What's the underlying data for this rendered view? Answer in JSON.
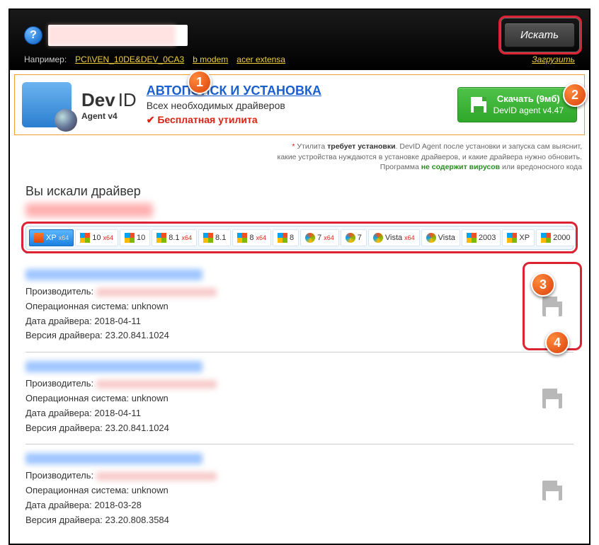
{
  "header": {
    "help_glyph": "?",
    "search_value": "",
    "search_button": "Искать",
    "example_label": "Например:",
    "example_links": [
      "PCI\\VEN_10DE&DEV_0CA3",
      "b modem",
      "acer extensa"
    ],
    "upload_link": "Загрузить"
  },
  "promo": {
    "brand_bold": "Dev",
    "brand_light": "ID",
    "agent_label": "Agent v4",
    "headline": "АВТОПОИСК И УСТАНОВКА",
    "subline": "Всех необходимых драйверов",
    "free_label": "Бесплатная утилита",
    "download_title": "Скачать (9мб)",
    "download_sub": "DevID agent v4.47"
  },
  "fineprint": {
    "star": "*",
    "line1_a": "Утилита ",
    "line1_b": "требует установки",
    "line1_c": ". DevID Agent после установки и запуска сам выяснит,",
    "line2": "какие устройства нуждаются в установке драйверов, и какие драйвера нужно обновить.",
    "line3_a": "Программа ",
    "line3_b": "не содержит вирусов",
    "line3_c": " или вредоносного кода"
  },
  "results": {
    "heading": "Вы искали драйвер",
    "os_tabs": [
      {
        "label": "XP",
        "sup": "x64",
        "active": true,
        "icon": "xp"
      },
      {
        "label": "10",
        "sup": "x64",
        "icon": "flag"
      },
      {
        "label": "10",
        "sup": "",
        "icon": "flag"
      },
      {
        "label": "8.1",
        "sup": "x64",
        "icon": "flag"
      },
      {
        "label": "8.1",
        "sup": "",
        "icon": "flag"
      },
      {
        "label": "8",
        "sup": "x64",
        "icon": "flag"
      },
      {
        "label": "8",
        "sup": "",
        "icon": "flag"
      },
      {
        "label": "7",
        "sup": "x64",
        "icon": "orb"
      },
      {
        "label": "7",
        "sup": "",
        "icon": "orb"
      },
      {
        "label": "Vista",
        "sup": "x64",
        "icon": "orb"
      },
      {
        "label": "Vista",
        "sup": "",
        "icon": "orb"
      },
      {
        "label": "2003",
        "sup": "",
        "icon": "xp"
      },
      {
        "label": "XP",
        "sup": "",
        "icon": "xp"
      },
      {
        "label": "2000",
        "sup": "",
        "icon": "xp"
      }
    ],
    "field_labels": {
      "manufacturer": "Производитель:",
      "os": "Операционная система:",
      "date": "Дата драйвера:",
      "version": "Версия драйвера:"
    },
    "drivers": [
      {
        "os": "unknown",
        "date": "2018-04-11",
        "version": "23.20.841.1024"
      },
      {
        "os": "unknown",
        "date": "2018-04-11",
        "version": "23.20.841.1024"
      },
      {
        "os": "unknown",
        "date": "2018-03-28",
        "version": "23.20.808.3584"
      }
    ]
  },
  "callouts": {
    "b1": "1",
    "b2": "2",
    "b3": "3",
    "b4": "4"
  }
}
